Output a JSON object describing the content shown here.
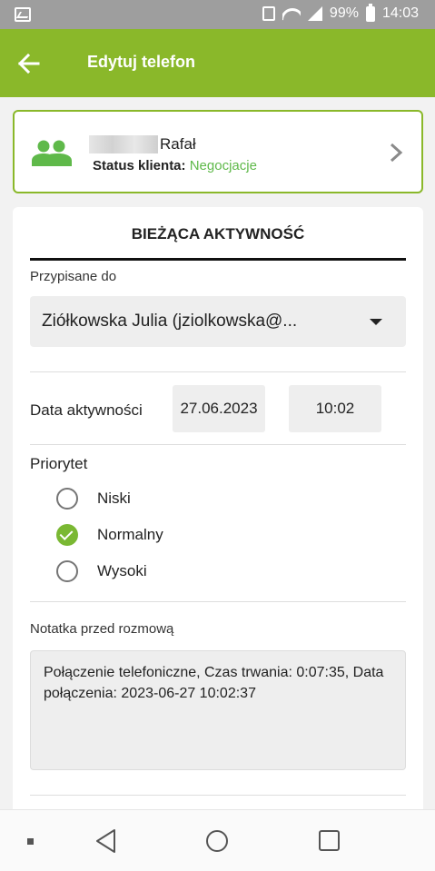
{
  "status_bar": {
    "battery": "99%",
    "time": "14:03"
  },
  "app_bar": {
    "title": "Edytuj telefon"
  },
  "client": {
    "name": "Rafał",
    "status_label": "Status klienta:",
    "status_value": "Negocjacje"
  },
  "activity": {
    "section_title": "BIEŻĄCA AKTYWNOŚĆ",
    "assigned_label": "Przypisane do",
    "assigned_value": "Ziółkowska Julia (jziolkowska@...",
    "date_label": "Data aktywności",
    "date_value": "27.06.2023",
    "time_value": "10:02",
    "priority_label": "Priorytet",
    "priority_options": [
      {
        "label": "Niski",
        "selected": false
      },
      {
        "label": "Normalny",
        "selected": true
      },
      {
        "label": "Wysoki",
        "selected": false
      }
    ],
    "note_label": "Notatka przed rozmową",
    "note_value": "Połączenie telefoniczne, Czas trwania: 0:07:35, Data połączenia: 2023-06-27 10:02:37"
  },
  "colors": {
    "accent": "#8ab82a",
    "status_green": "#5fb94a",
    "radio_checked": "#7ab833"
  },
  "icons": {
    "back": "arrow-left-icon",
    "client": "people-icon",
    "chevron": "chevron-right-icon",
    "dropdown": "caret-down-icon"
  }
}
